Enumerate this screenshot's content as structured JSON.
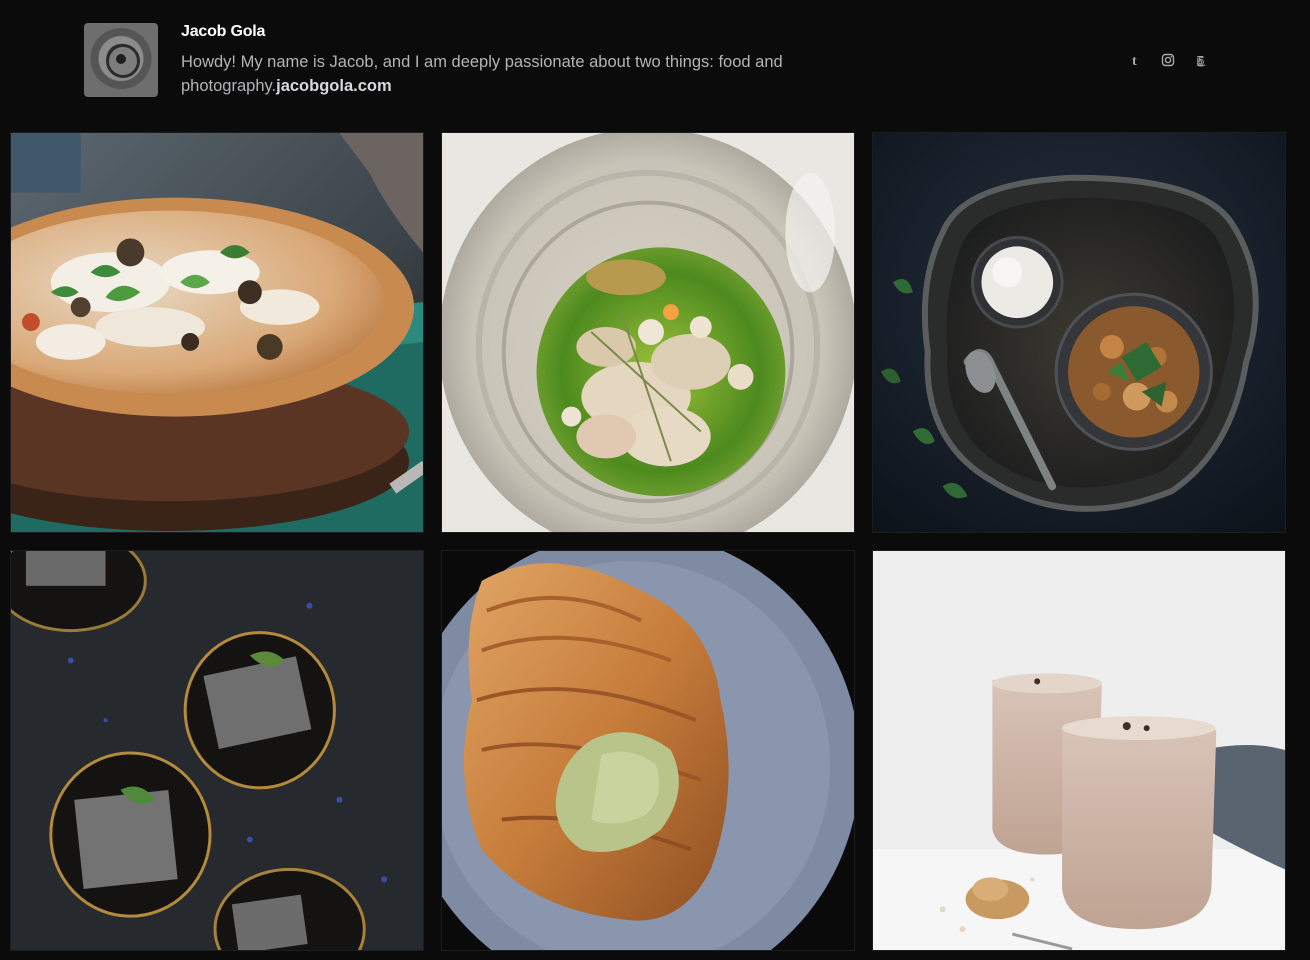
{
  "profile": {
    "name": "Jacob Gola",
    "bio": "Howdy! My name is Jacob, and I am deeply passionate about two things: food and photography.",
    "link_text": "jacobgola.com"
  },
  "social": [
    {
      "icon": "tumblr-icon",
      "glyph": "t"
    },
    {
      "icon": "instagram-icon",
      "glyph": "◎"
    },
    {
      "icon": "500px-icon",
      "glyph": "5"
    }
  ],
  "photos": [
    {
      "subject": "pizza"
    },
    {
      "subject": "mussels-in-green-broth"
    },
    {
      "subject": "curry-with-rice"
    },
    {
      "subject": "brownies"
    },
    {
      "subject": "croissant"
    },
    {
      "subject": "smoothies"
    }
  ],
  "colors": {
    "background": "#0b0b0c",
    "name": "#ffffff",
    "bio": "#b4b4b8"
  }
}
